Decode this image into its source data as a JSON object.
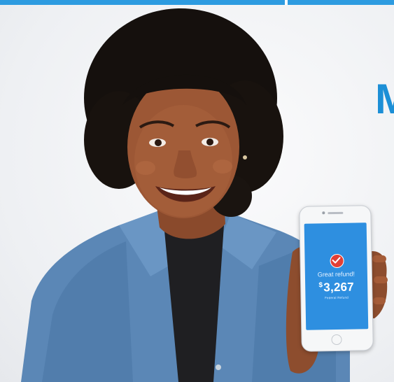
{
  "headline": {
    "partial_text": "M"
  },
  "phone_screen": {
    "check_icon": "checkmark-icon",
    "title": "Great refund!",
    "currency_symbol": "$",
    "amount": "3,267",
    "caption": "Federal Refund"
  },
  "colors": {
    "brand_blue": "#2d9be0",
    "headline_blue": "#1c8fd6",
    "screen_blue": "#2e8fe0",
    "check_red": "#e23f35",
    "shirt_denim": "#5b87b6"
  }
}
